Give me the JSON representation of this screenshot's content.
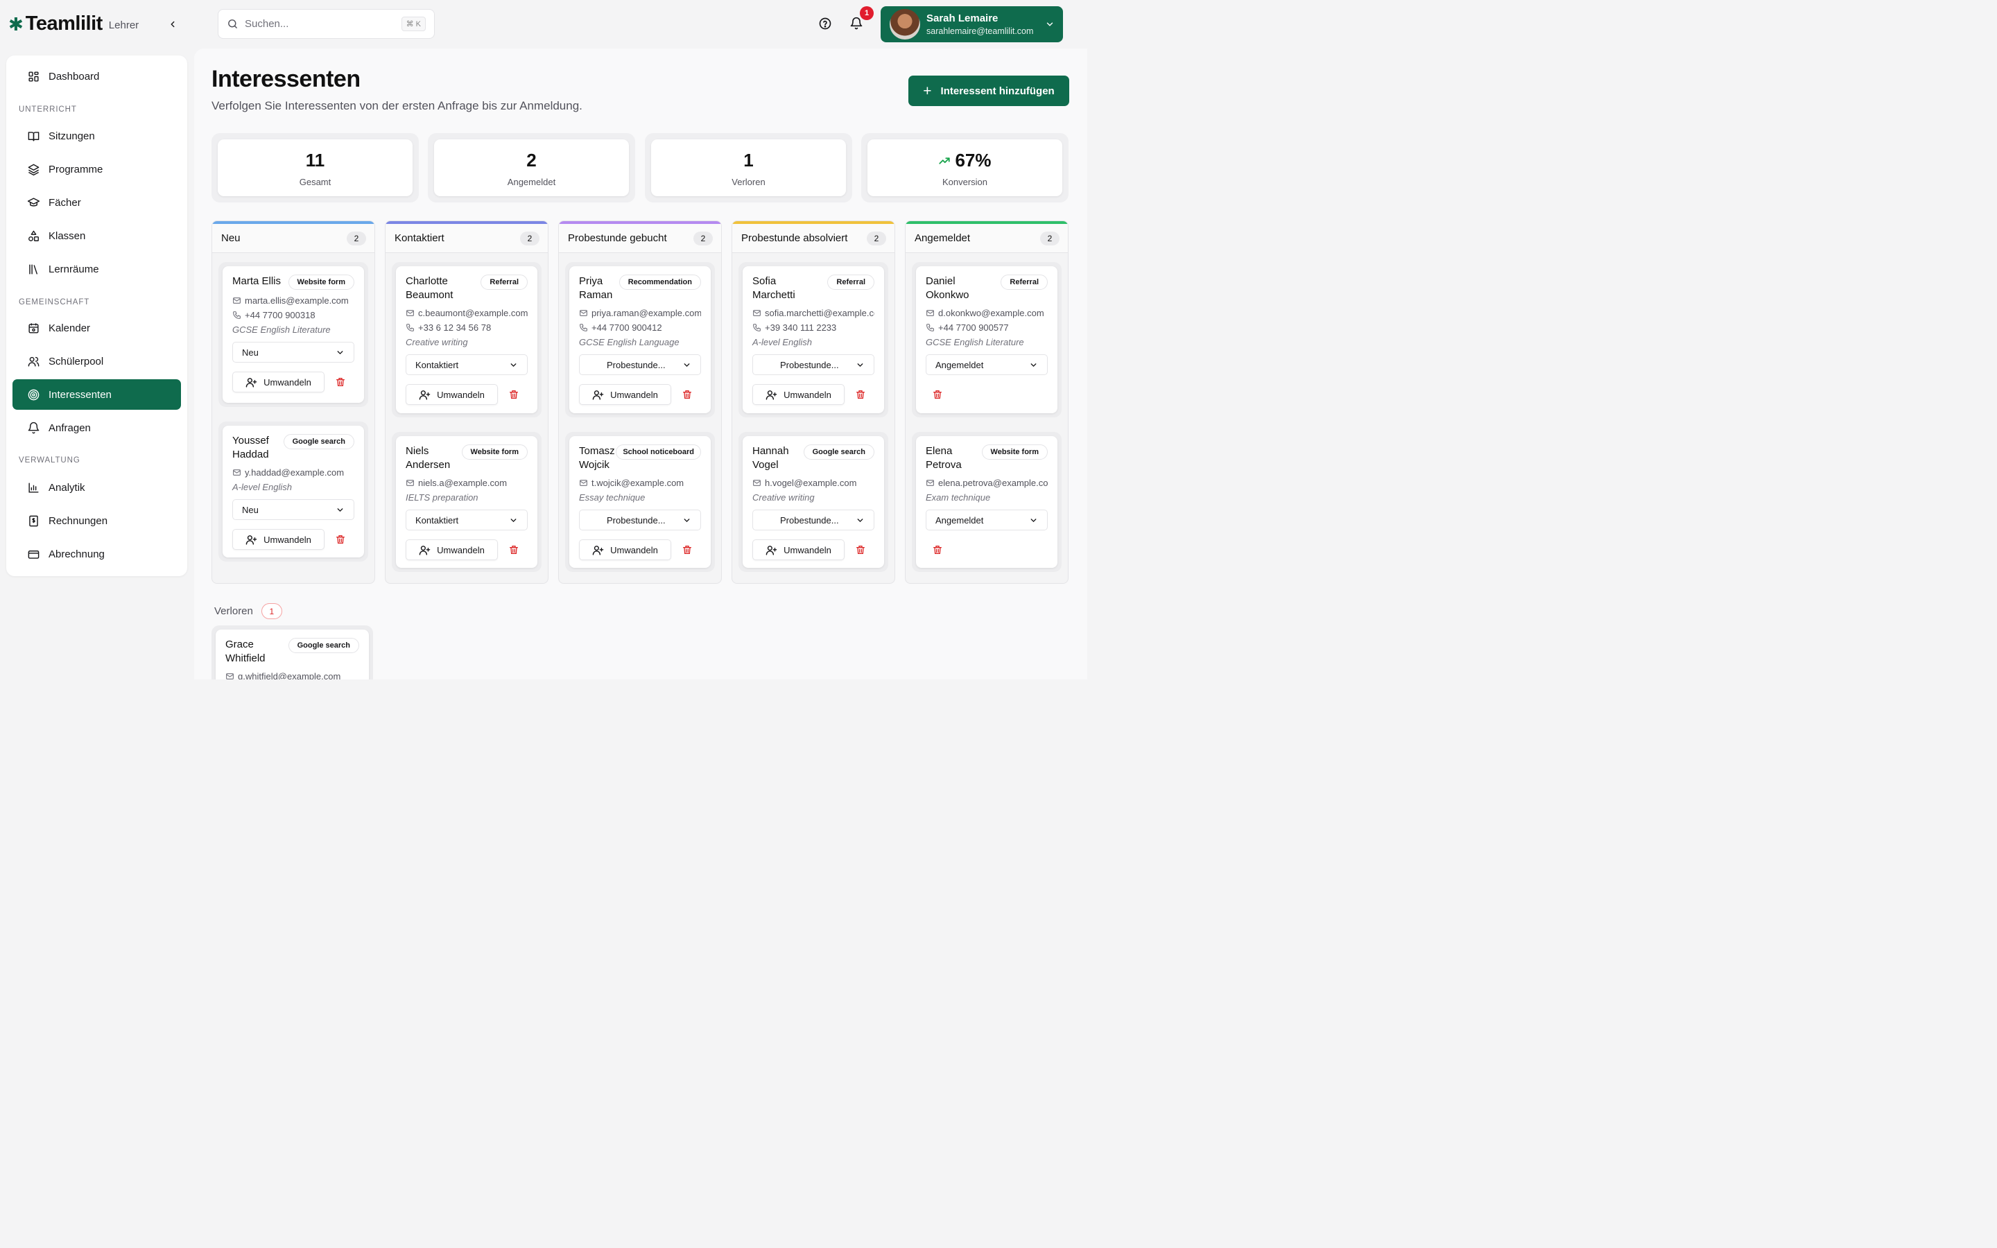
{
  "brand": {
    "name": "Teamlilit",
    "role": "Lehrer"
  },
  "search": {
    "placeholder": "Suchen...",
    "shortcut": "⌘ K"
  },
  "notifications": {
    "count": "1"
  },
  "user": {
    "name": "Sarah Lemaire",
    "email": "sarahlemaire@teamlilit.com"
  },
  "sidebar": {
    "dashboard": "Dashboard",
    "section_unterricht": "UNTERRICHT",
    "sitzungen": "Sitzungen",
    "programme": "Programme",
    "faecher": "Fächer",
    "klassen": "Klassen",
    "lernraeume": "Lernräume",
    "section_gemeinschaft": "GEMEINSCHAFT",
    "kalender": "Kalender",
    "schuelerpool": "Schülerpool",
    "interessenten": "Interessenten",
    "anfragen": "Anfragen",
    "section_verwaltung": "VERWALTUNG",
    "analytik": "Analytik",
    "rechnungen": "Rechnungen",
    "abrechnung": "Abrechnung"
  },
  "page": {
    "title": "Interessenten",
    "subtitle": "Verfolgen Sie Interessenten von der ersten Anfrage bis zur Anmeldung.",
    "add_button": "Interessent hinzufügen"
  },
  "stats": {
    "total": {
      "value": "11",
      "label": "Gesamt"
    },
    "enrolled": {
      "value": "2",
      "label": "Angemeldet"
    },
    "lost": {
      "value": "1",
      "label": "Verloren"
    },
    "conversion": {
      "value": "67%",
      "label": "Konversion"
    }
  },
  "convert_label": "Umwandeln",
  "columns": {
    "neu": {
      "title": "Neu",
      "count": "2",
      "color": "#6aa8ea"
    },
    "kontaktiert": {
      "title": "Kontaktiert",
      "count": "2",
      "color": "#7b86e4"
    },
    "probe_gebucht": {
      "title": "Probestunde gebucht",
      "count": "2",
      "color": "#b58af0"
    },
    "probe_absolviert": {
      "title": "Probestunde absolviert",
      "count": "2",
      "color": "#f0c23c"
    },
    "angemeldet": {
      "title": "Angemeldet",
      "count": "2",
      "color": "#2fbf6a"
    }
  },
  "cards": {
    "marta": {
      "name": "Marta Ellis",
      "source": "Website form",
      "email": "marta.ellis@example.com",
      "phone": "+44 7700 900318",
      "subject": "GCSE English Literature",
      "status": "Neu"
    },
    "youssef": {
      "name_1": "Youssef",
      "name_2": "Haddad",
      "source": "Google search",
      "email": "y.haddad@example.com",
      "subject": "A-level English",
      "status": "Neu"
    },
    "charlotte": {
      "name_1": "Charlotte",
      "name_2": "Beaumont",
      "source": "Referral",
      "email": "c.beaumont@example.com",
      "phone": "+33 6 12 34 56 78",
      "subject": "Creative writing",
      "status": "Kontaktiert"
    },
    "niels": {
      "name_1": "Niels",
      "name_2": "Andersen",
      "source": "Website form",
      "email": "niels.a@example.com",
      "subject": "IELTS preparation",
      "status": "Kontaktiert"
    },
    "priya": {
      "name_1": "Priya",
      "name_2": "Raman",
      "source": "Recommendation",
      "email": "priya.raman@example.com",
      "phone": "+44 7700 900412",
      "subject": "GCSE English Language",
      "status": "Probestunde..."
    },
    "tomasz": {
      "name_1": "Tomasz",
      "name_2": "Wojcik",
      "source": "School noticeboard",
      "email": "t.wojcik@example.com",
      "subject": "Essay technique",
      "status": "Probestunde..."
    },
    "sofia": {
      "name_1": "Sofia",
      "name_2": "Marchetti",
      "source": "Referral",
      "email": "sofia.marchetti@example.com",
      "phone": "+39 340 111 2233",
      "subject": "A-level English",
      "status": "Probestunde..."
    },
    "hannah": {
      "name_1": "Hannah",
      "name_2": "Vogel",
      "source": "Google search",
      "email": "h.vogel@example.com",
      "subject": "Creative writing",
      "status": "Probestunde..."
    },
    "daniel": {
      "name_1": "Daniel",
      "name_2": "Okonkwo",
      "source": "Referral",
      "email": "d.okonkwo@example.com",
      "phone": "+44 7700 900577",
      "subject": "GCSE English Literature",
      "status": "Angemeldet"
    },
    "elena": {
      "name_1": "Elena",
      "name_2": "Petrova",
      "source": "Website form",
      "email": "elena.petrova@example.com",
      "subject": "Exam technique",
      "status": "Angemeldet"
    },
    "grace": {
      "name_1": "Grace",
      "name_2": "Whitfield",
      "source": "Google search",
      "email": "g.whitfield@example.com"
    }
  },
  "lost_section": {
    "label": "Verloren",
    "count": "1"
  },
  "colors": {
    "brand": "#0f6b4d",
    "danger": "#dc2626",
    "trend_up": "#16a34a"
  }
}
